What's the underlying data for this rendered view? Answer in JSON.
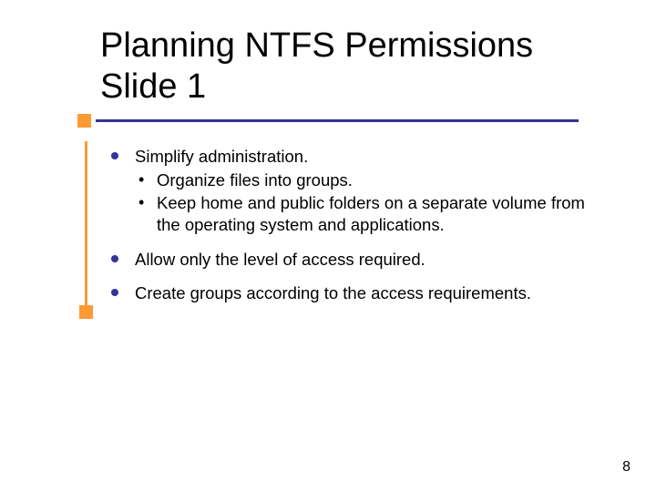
{
  "title": "Planning NTFS Permissions Slide 1",
  "bullets": [
    {
      "text": "Simplify administration.",
      "sub": [
        "Organize files into groups.",
        "Keep home and public folders on a separate volume from the operating system and applications."
      ]
    },
    {
      "text": "Allow only the level of access required.",
      "sub": []
    },
    {
      "text": "Create groups according to the access requirements.",
      "sub": []
    }
  ],
  "page_number": "8"
}
